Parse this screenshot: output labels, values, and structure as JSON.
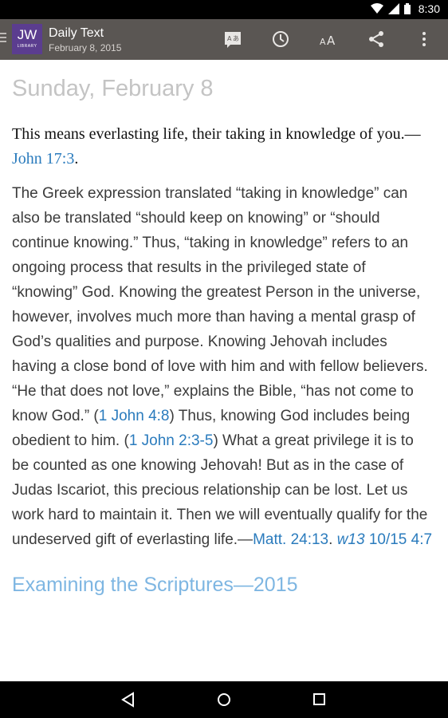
{
  "status_bar": {
    "time": "8:30"
  },
  "app_bar": {
    "logo_text": "JW",
    "logo_sub": "LIBRARY",
    "title": "Daily Text",
    "subtitle": "February 8, 2015",
    "actions": [
      "translate-icon",
      "history-icon",
      "text-size-icon",
      "share-icon",
      "more-vert-icon"
    ]
  },
  "article": {
    "date_heading": "Sunday, February 8",
    "theme_text": "This means everlasting life, their taking in knowledge of you.—",
    "theme_ref": "John 17:3",
    "theme_end": ".",
    "body_1": "The Greek expression translated “taking in knowledge” can also be translated “should keep on knowing” or “should continue knowing.” Thus, “taking in knowledge” refers to an ongoing process that results in the privileged state of “knowing” God. Knowing the greatest Person in the universe, however, involves much more than having a mental grasp of God’s qualities and purpose. Knowing Jehovah includes having a close bond of love with him and with fellow believers. “He that does not love,” explains the Bible, “has not come to know God.” (",
    "ref_1": "1 John 4:8",
    "body_2": ") Thus, knowing God includes being obedient to him. (",
    "ref_2": "1 John 2:3-5",
    "body_3": ") What a great privilege it is to be counted as one knowing Jehovah! But as in the case of Judas Iscariot, this precious relationship can be lost. Let us work hard to maintain it. Then we will eventually qualify for the undeserved gift of everlasting life.—",
    "ref_3": "Matt. 24:13",
    "sep": ". ",
    "ref_4": "w13",
    "ref_5": " 10/15 4:7",
    "source_title": "Examining the Scriptures—2015"
  },
  "colors": {
    "app_bar": "#5a5653",
    "logo": "#5b3d8f",
    "link": "#2a7bbd",
    "source": "#7eb6e2"
  }
}
